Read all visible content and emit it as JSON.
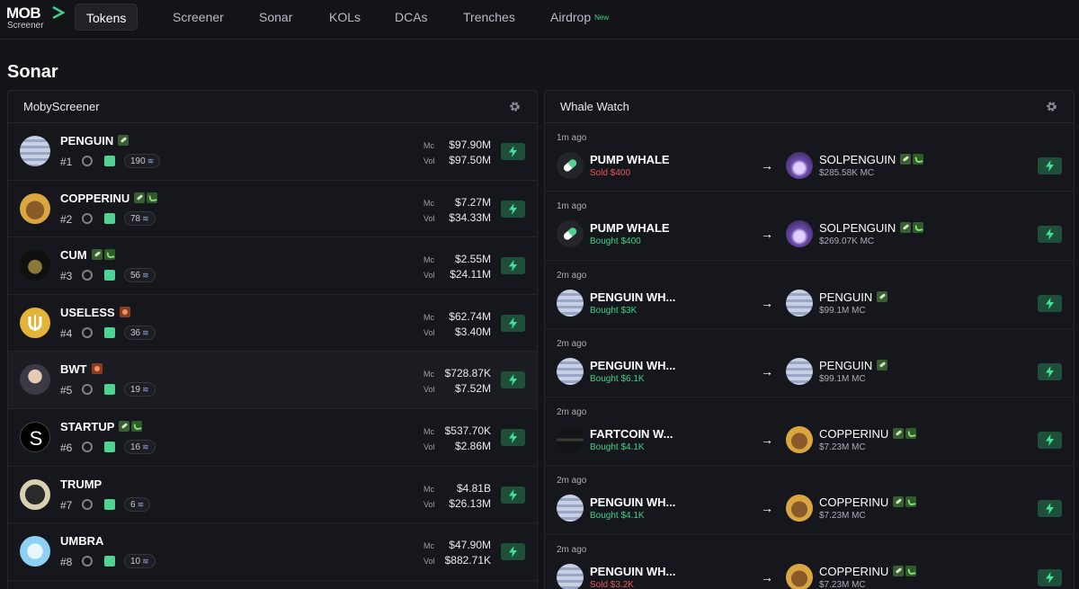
{
  "brand": {
    "logo": "MOB",
    "sub": "Screener"
  },
  "nav": {
    "tokens": "Tokens",
    "screener": "Screener",
    "sonar": "Sonar",
    "kols": "KOLs",
    "dcas": "DCAs",
    "trenches": "Trenches",
    "airdrop": "Airdrop",
    "airdrop_badge": "New"
  },
  "page_title": "Sonar",
  "left_panel": {
    "title": "MobyScreener",
    "mc_label": "Mc",
    "vol_label": "Vol",
    "rows": [
      {
        "name": "PENGUIN",
        "rank": "#1",
        "holders": "190",
        "mc": "$97.90M",
        "vol": "$97.50M",
        "tags": [
          "pill"
        ]
      },
      {
        "name": "COPPERINU",
        "rank": "#2",
        "holders": "78",
        "mc": "$7.27M",
        "vol": "$34.33M",
        "tags": [
          "pill",
          "sprout"
        ]
      },
      {
        "name": "CUM",
        "rank": "#3",
        "holders": "56",
        "mc": "$2.55M",
        "vol": "$24.11M",
        "tags": [
          "pill",
          "sprout"
        ]
      },
      {
        "name": "USELESS",
        "rank": "#4",
        "holders": "36",
        "mc": "$62.74M",
        "vol": "$3.40M",
        "tags": [
          "orange"
        ]
      },
      {
        "name": "BWT",
        "rank": "#5",
        "holders": "19",
        "mc": "$728.87K",
        "vol": "$7.52M",
        "tags": [
          "orange"
        ]
      },
      {
        "name": "STARTUP",
        "rank": "#6",
        "holders": "16",
        "mc": "$537.70K",
        "vol": "$2.86M",
        "tags": [
          "pill",
          "sprout"
        ]
      },
      {
        "name": "TRUMP",
        "rank": "#7",
        "holders": "6",
        "mc": "$4.81B",
        "vol": "$26.13M",
        "tags": []
      },
      {
        "name": "UMBRA",
        "rank": "#8",
        "holders": "10",
        "mc": "$47.90M",
        "vol": "$882.71K",
        "tags": []
      }
    ]
  },
  "right_panel": {
    "title": "Whale Watch",
    "rows": [
      {
        "time": "1m ago",
        "whale": "PUMP WHALE",
        "action": "Sold $400",
        "kind": "sell",
        "token": "SOLPENGUIN",
        "mc": "$285.58K MC",
        "tags": [
          "pill",
          "sprout"
        ]
      },
      {
        "time": "1m ago",
        "whale": "PUMP WHALE",
        "action": "Bought $400",
        "kind": "buy",
        "token": "SOLPENGUIN",
        "mc": "$269.07K MC",
        "tags": [
          "pill",
          "sprout"
        ]
      },
      {
        "time": "2m ago",
        "whale": "PENGUIN WH...",
        "action": "Bought $3K",
        "kind": "buy",
        "token": "PENGUIN",
        "mc": "$99.1M MC",
        "tags": [
          "pill"
        ]
      },
      {
        "time": "2m ago",
        "whale": "PENGUIN WH...",
        "action": "Bought $6.1K",
        "kind": "buy",
        "token": "PENGUIN",
        "mc": "$99.1M MC",
        "tags": [
          "pill"
        ]
      },
      {
        "time": "2m ago",
        "whale": "FARTCOIN W...",
        "action": "Bought $4.1K",
        "kind": "buy",
        "token": "COPPERINU",
        "mc": "$7.23M MC",
        "tags": [
          "pill",
          "sprout"
        ]
      },
      {
        "time": "2m ago",
        "whale": "PENGUIN WH...",
        "action": "Bought $4.1K",
        "kind": "buy",
        "token": "COPPERINU",
        "mc": "$7.23M MC",
        "tags": [
          "pill",
          "sprout"
        ]
      },
      {
        "time": "2m ago",
        "whale": "PENGUIN WH...",
        "action": "Sold $3.2K",
        "kind": "sell",
        "token": "COPPERINU",
        "mc": "$7.23M MC",
        "tags": [
          "pill",
          "sprout"
        ]
      }
    ]
  }
}
